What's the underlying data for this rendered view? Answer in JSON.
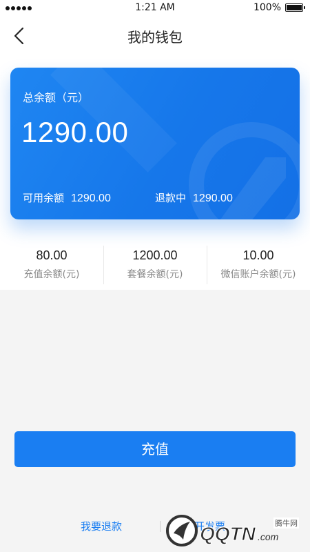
{
  "status_bar": {
    "time": "1:21 AM",
    "battery_percent": "100%"
  },
  "nav": {
    "title": "我的钱包"
  },
  "card": {
    "label": "总余额（元）",
    "amount": "1290.00",
    "available_label": "可用余额",
    "available_value": "1290.00",
    "refunding_label": "退款中",
    "refunding_value": "1290.00"
  },
  "stats": [
    {
      "value": "80.00",
      "label": "充值余额(元)"
    },
    {
      "value": "1200.00",
      "label": "套餐余额(元)"
    },
    {
      "value": "10.00",
      "label": "微信账户余额(元)"
    }
  ],
  "actions": {
    "recharge_label": "充值",
    "refund_label": "我要退款",
    "invoice_label": "开发票"
  },
  "watermark": {
    "logo_text": "QQTN.com",
    "site_label": "腾牛网"
  },
  "colors": {
    "accent": "#1a7ef2",
    "card_gradient_start": "#1f86f2",
    "card_gradient_end": "#1470e6"
  }
}
